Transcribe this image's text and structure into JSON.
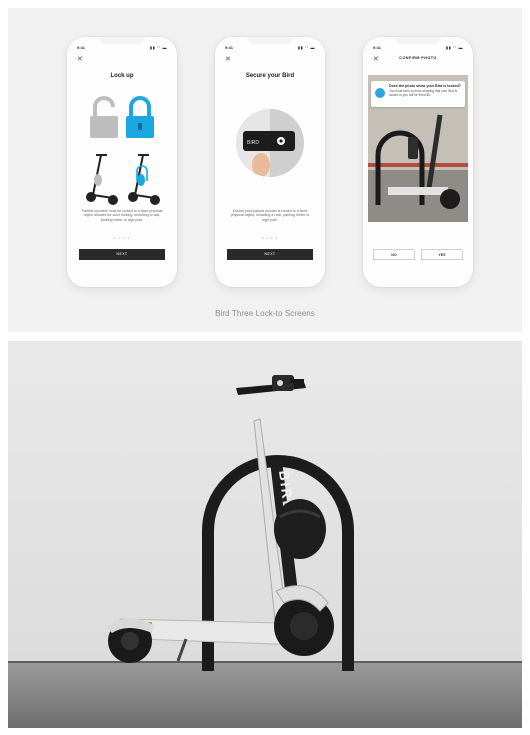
{
  "caption": "Bird Three Lock-to Screens",
  "screens": [
    {
      "time": "9:41",
      "title": "Lock up",
      "body": "Parked scooters must be locked to a fixed physical object allowed for such locking, including a rack, parking meter or sign pole.",
      "dots": "• • • •",
      "button": "NEXT"
    },
    {
      "time": "9:41",
      "title": "Secure your Bird",
      "body": "Ensure your parked scooter is locked to a fixed physical object, including a rack, parking meter or sign pole.",
      "dots": "• • • •",
      "button": "NEXT"
    },
    {
      "time": "9:41",
      "header": "CONFIRM PHOTO",
      "alert_title": "Does the photo show your Bird is locked?",
      "alert_body": "You must send a photo showing that your Bird is locked or you will be fined $5.",
      "no_label": "NO",
      "yes_label": "YES"
    }
  ],
  "colors": {
    "accent": "#1aa7e0",
    "lock_gray": "#bdbdbd",
    "panel_bg": "#f1f1f1"
  },
  "scooter_brand": "BIRD"
}
